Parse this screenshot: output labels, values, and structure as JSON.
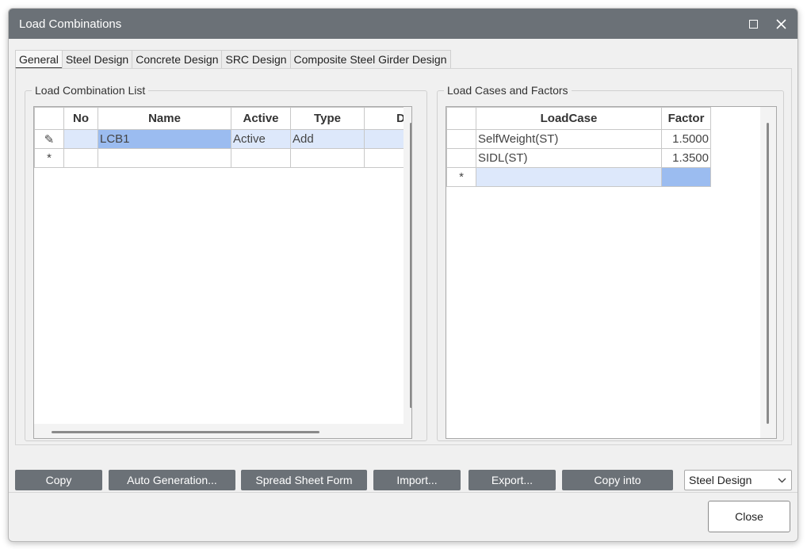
{
  "window": {
    "title": "Load Combinations"
  },
  "tabs": [
    {
      "label": "General"
    },
    {
      "label": "Steel Design"
    },
    {
      "label": "Concrete Design"
    },
    {
      "label": "SRC Design"
    },
    {
      "label": "Composite Steel Girder Design"
    }
  ],
  "combination_list": {
    "legend": "Load Combination List",
    "columns": [
      "No",
      "Name",
      "Active",
      "Type",
      "D"
    ],
    "rows": [
      {
        "indicator": "✎",
        "no": "",
        "name": "LCB1",
        "active": "Active",
        "type": "Add",
        "d": ""
      },
      {
        "indicator": "*",
        "no": "",
        "name": "",
        "active": "",
        "type": "",
        "d": ""
      }
    ]
  },
  "load_cases": {
    "legend": "Load Cases and Factors",
    "columns": [
      "LoadCase",
      "Factor"
    ],
    "rows": [
      {
        "indicator": "",
        "loadcase": "SelfWeight(ST)",
        "factor": "1.5000"
      },
      {
        "indicator": "",
        "loadcase": "SIDL(ST)",
        "factor": "1.3500"
      },
      {
        "indicator": "*",
        "loadcase": "",
        "factor": ""
      }
    ]
  },
  "buttons": {
    "copy": "Copy",
    "auto_generation": "Auto Generation...",
    "spread_sheet": "Spread Sheet Form",
    "import": "Import...",
    "export": "Export...",
    "copy_into": "Copy into",
    "close": "Close"
  },
  "design_select": {
    "value": "Steel Design"
  },
  "colors": {
    "titlebar": "#6b7177",
    "selected_cell": "#9bbcf0",
    "highlight_row": "#dde8fb",
    "button": "#6b7177"
  }
}
